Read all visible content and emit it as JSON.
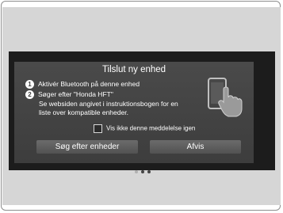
{
  "dialog": {
    "title": "Tilslut ny enhed",
    "steps": [
      {
        "number": "1",
        "text": "Aktivér Bluetooth på denne enhed"
      },
      {
        "number": "2",
        "text": "Søger efter \"Honda HFT\""
      }
    ],
    "info_line1": "Se websiden angivet i instruktionsbogen for en",
    "info_line2": "liste over kompatible enheder.",
    "checkbox_label": "Vis ikke denne meddelelse igen",
    "checkbox_checked": false,
    "buttons": {
      "search": "Søg efter enheder",
      "decline": "Afvis"
    },
    "illustration_icon": "phone-touch-icon",
    "page_indicator": {
      "total": 3,
      "active": 1
    }
  }
}
